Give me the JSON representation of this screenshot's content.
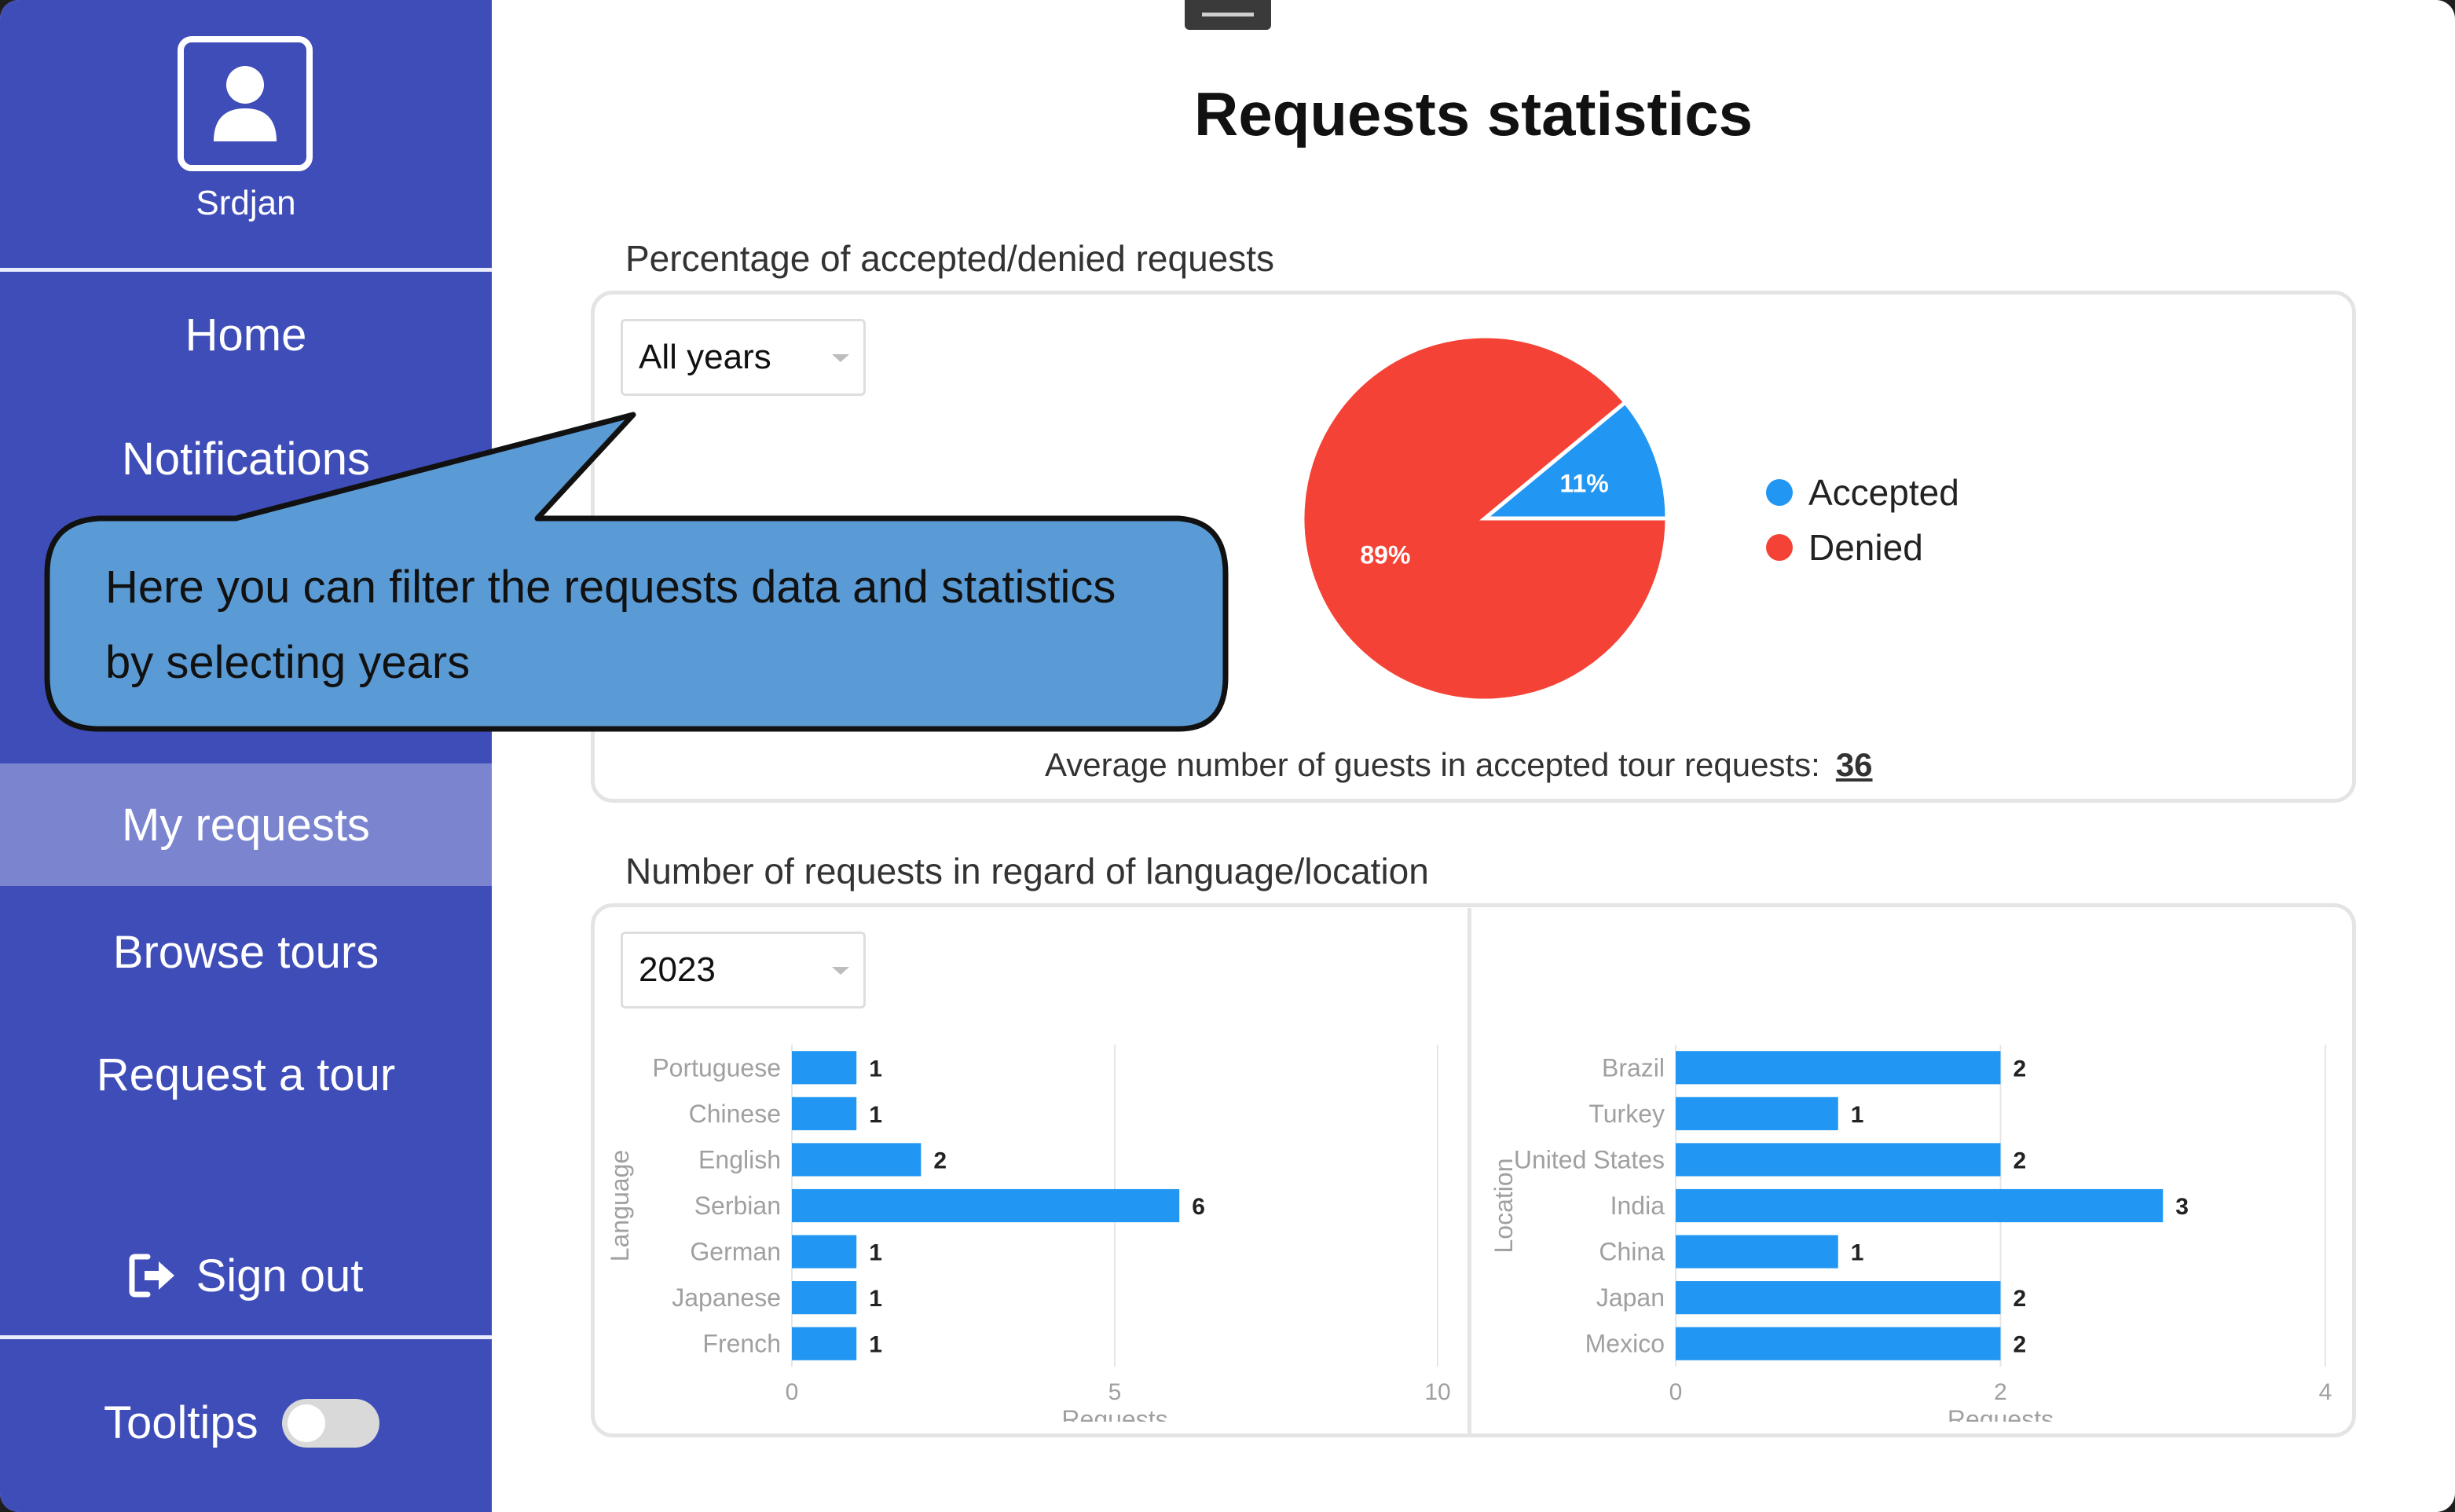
{
  "sidebar": {
    "user_name": "Srdjan",
    "items": [
      {
        "label": "Home"
      },
      {
        "label": "Notifications"
      },
      {
        "label": "My requests",
        "active": true
      },
      {
        "label": "Browse tours"
      },
      {
        "label": "Request a tour"
      }
    ],
    "sign_out": "Sign out",
    "sign_out_icon": "sign-out-icon",
    "tooltips_label": "Tooltips",
    "tooltips_enabled": false
  },
  "main": {
    "title": "Requests statistics",
    "pie_section": {
      "title": "Percentage of accepted/denied requests",
      "filter_value": "All years",
      "avg_label": "Average number of guests in accepted tour requests:",
      "avg_value": "36"
    },
    "bar_section": {
      "title": "Number of requests in regard of language/location",
      "filter_value": "2023"
    }
  },
  "callout": {
    "line1": "Here you can filter the requests data and statistics",
    "line2": "by selecting years"
  },
  "colors": {
    "sidebar": "#3f4db8",
    "sidebar_active": "#7b85cf",
    "accepted": "#2196f3",
    "denied": "#f44336",
    "bar": "#2196f3",
    "callout": "#5b9bd5"
  },
  "chart_data": [
    {
      "type": "pie",
      "labels": [
        "Accepted",
        "Denied"
      ],
      "values": [
        11,
        89
      ],
      "data_labels": [
        "11%",
        "89%"
      ],
      "legend_position": "right"
    },
    {
      "type": "bar",
      "orientation": "horizontal",
      "categories": [
        "Portuguese",
        "Chinese",
        "English",
        "Serbian",
        "German",
        "Japanese",
        "French"
      ],
      "values": [
        1,
        1,
        2,
        6,
        1,
        1,
        1
      ],
      "xlabel": "Requests",
      "ylabel": "Language",
      "xlim": [
        0,
        10
      ],
      "xticks": [
        "0",
        "5",
        "10"
      ],
      "grid": true
    },
    {
      "type": "bar",
      "orientation": "horizontal",
      "categories": [
        "Brazil",
        "Turkey",
        "United States",
        "India",
        "China",
        "Japan",
        "Mexico"
      ],
      "values": [
        2,
        1,
        2,
        3,
        1,
        2,
        2
      ],
      "xlabel": "Requests",
      "ylabel": "Location",
      "xlim": [
        0,
        4
      ],
      "xticks": [
        "0",
        "2",
        "4"
      ],
      "grid": true
    }
  ]
}
